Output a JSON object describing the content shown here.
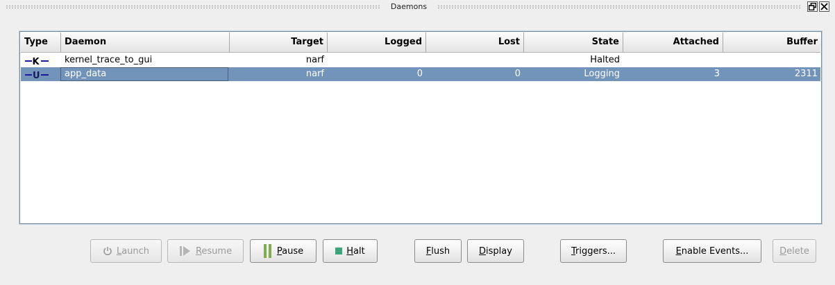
{
  "window": {
    "title": "Daemons"
  },
  "table": {
    "columns": [
      "Type",
      "Daemon",
      "Target",
      "Logged",
      "Lost",
      "State",
      "Attached",
      "Buffer"
    ],
    "rows": [
      {
        "type": "K",
        "daemon": "kernel_trace_to_gui",
        "target": "narf",
        "logged": "",
        "lost": "",
        "state": "Halted",
        "attached": "",
        "buffer": ""
      },
      {
        "type": "U",
        "daemon": "app_data",
        "target": "narf",
        "logged": "0",
        "lost": "0",
        "state": "Logging",
        "attached": "3",
        "buffer": "2311"
      }
    ]
  },
  "buttons": {
    "launch": {
      "pre": "",
      "key": "L",
      "post": "aunch"
    },
    "resume": {
      "pre": "",
      "key": "R",
      "post": "esume"
    },
    "pause": {
      "pre": "",
      "key": "P",
      "post": "ause"
    },
    "halt": {
      "pre": "",
      "key": "H",
      "post": "alt"
    },
    "flush": {
      "pre": "",
      "key": "F",
      "post": "lush"
    },
    "display": {
      "pre": "",
      "key": "D",
      "post": "isplay"
    },
    "triggers": {
      "pre": "",
      "key": "T",
      "post": "riggers..."
    },
    "enable_events": {
      "pre": "",
      "key": "E",
      "post": "nable Events..."
    },
    "delete": {
      "pre": "",
      "key": "D",
      "post": "elete"
    }
  },
  "colors": {
    "selection": "#7294bb",
    "kernel_icon": "#1a1aa0",
    "user_icon": "#1a1aa0"
  },
  "icons": {
    "launch": "power-icon",
    "resume": "play-icon",
    "pause": "pause-icon",
    "halt": "stop-icon",
    "restore": "restore-icon",
    "close": "close-icon"
  }
}
